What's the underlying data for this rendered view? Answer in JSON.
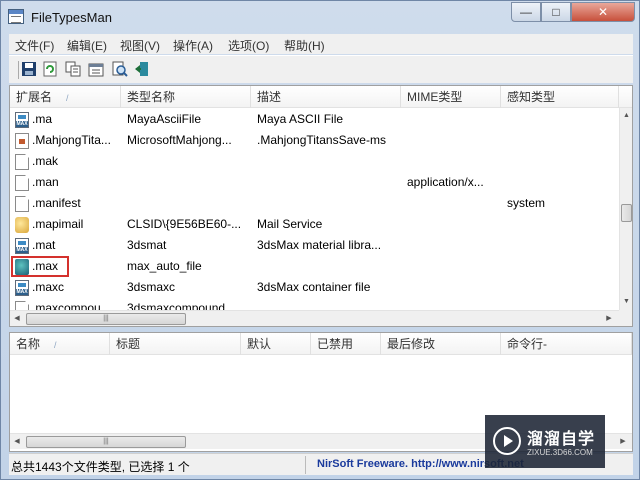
{
  "window": {
    "title": "FileTypesMan",
    "controls": [
      "—",
      "□",
      "✕"
    ]
  },
  "menu": [
    "文件(F)",
    "编辑(E)",
    "视图(V)",
    "操作(A)",
    "选项(O)",
    "帮助(H)"
  ],
  "toolbar": [
    "save-icon",
    "refresh-icon",
    "copy-icon",
    "properties-icon",
    "find-icon",
    "exit-icon"
  ],
  "file_list": {
    "columns": [
      "扩展名",
      "类型名称",
      "描述",
      "MIME类型",
      "感知类型"
    ],
    "sort_indicator": "/",
    "rows": [
      {
        "icon": "max-file-icon",
        "ext": ".ma",
        "type": "MayaAsciiFile",
        "desc": "Maya ASCII File",
        "mime": "",
        "perceived": ""
      },
      {
        "icon": "mahjong-file-icon",
        "ext": ".MahjongTita...",
        "type": "MicrosoftMahjong...",
        "desc": ".MahjongTitansSave-ms",
        "mime": "",
        "perceived": ""
      },
      {
        "icon": "document-icon",
        "ext": ".mak",
        "type": "",
        "desc": "",
        "mime": "",
        "perceived": ""
      },
      {
        "icon": "document-icon",
        "ext": ".man",
        "type": "",
        "desc": "",
        "mime": "application/x...",
        "perceived": ""
      },
      {
        "icon": "document-icon",
        "ext": ".manifest",
        "type": "",
        "desc": "",
        "mime": "",
        "perceived": "system"
      },
      {
        "icon": "mail-icon",
        "ext": ".mapimail",
        "type": "CLSID\\{9E56BE60-...",
        "desc": "Mail Service",
        "mime": "",
        "perceived": ""
      },
      {
        "icon": "max-file-icon",
        "ext": ".mat",
        "type": "3dsmat",
        "desc": "3dsMax material libra...",
        "mime": "",
        "perceived": ""
      },
      {
        "icon": "max-app-icon",
        "ext": ".max",
        "type": "max_auto_file",
        "desc": "",
        "mime": "",
        "perceived": ""
      },
      {
        "icon": "max-file-icon",
        "ext": ".maxc",
        "type": "3dsmaxc",
        "desc": "3dsMax container file",
        "mime": "",
        "perceived": ""
      },
      {
        "icon": "document-icon",
        "ext": ".maxcompou...",
        "type": "3dsmaxcompound...",
        "desc": "",
        "mime": "",
        "perceived": ""
      }
    ]
  },
  "actions_list": {
    "columns": [
      "名称",
      "标题",
      "默认",
      "已禁用",
      "最后修改",
      "命令行-"
    ],
    "sort_indicator": "/"
  },
  "status": {
    "left": "总共1443个文件类型, 已选择 1 个",
    "right": "NirSoft Freeware.  http://www.nirsoft.net"
  },
  "watermark": {
    "title": "溜溜自学",
    "subtitle": "ZIXUE.3D66.COM"
  },
  "colors": {
    "selection_box": "#d4312d",
    "status_link": "#1a3a9c"
  }
}
